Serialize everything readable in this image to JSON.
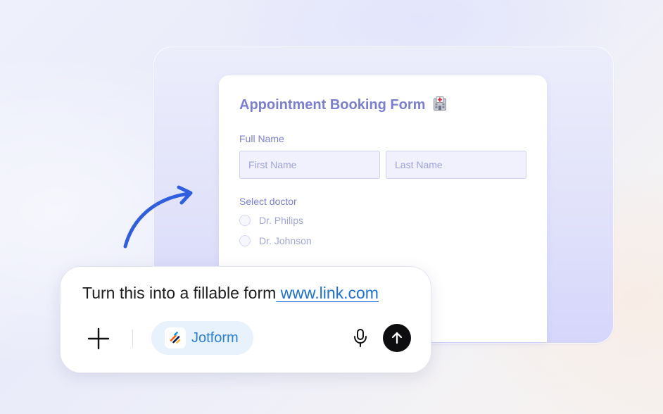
{
  "form": {
    "title": "Appointment Booking Form",
    "title_icon": "hospital-icon",
    "full_name_label": "Full Name",
    "first_name_placeholder": "First Name",
    "last_name_placeholder": "Last Name",
    "select_doctor_label": "Select doctor",
    "doctors": [
      "Dr. Philips",
      "Dr. Johnson"
    ]
  },
  "prompt": {
    "text": "Turn this into a fillable form",
    "link": " www.link.com",
    "plus_icon": "plus-icon",
    "chip_label": "Jotform",
    "chip_icon": "jotform-logo-icon",
    "mic_icon": "microphone-icon",
    "send_icon": "arrow-up-icon"
  },
  "colors": {
    "form_accent": "#7b7fd4",
    "link": "#1a6fdc",
    "chip_background": "#e8f2fd",
    "chip_text": "#2d7fd6",
    "arrow": "#2f5fe0",
    "send_button": "#0e0e10"
  }
}
